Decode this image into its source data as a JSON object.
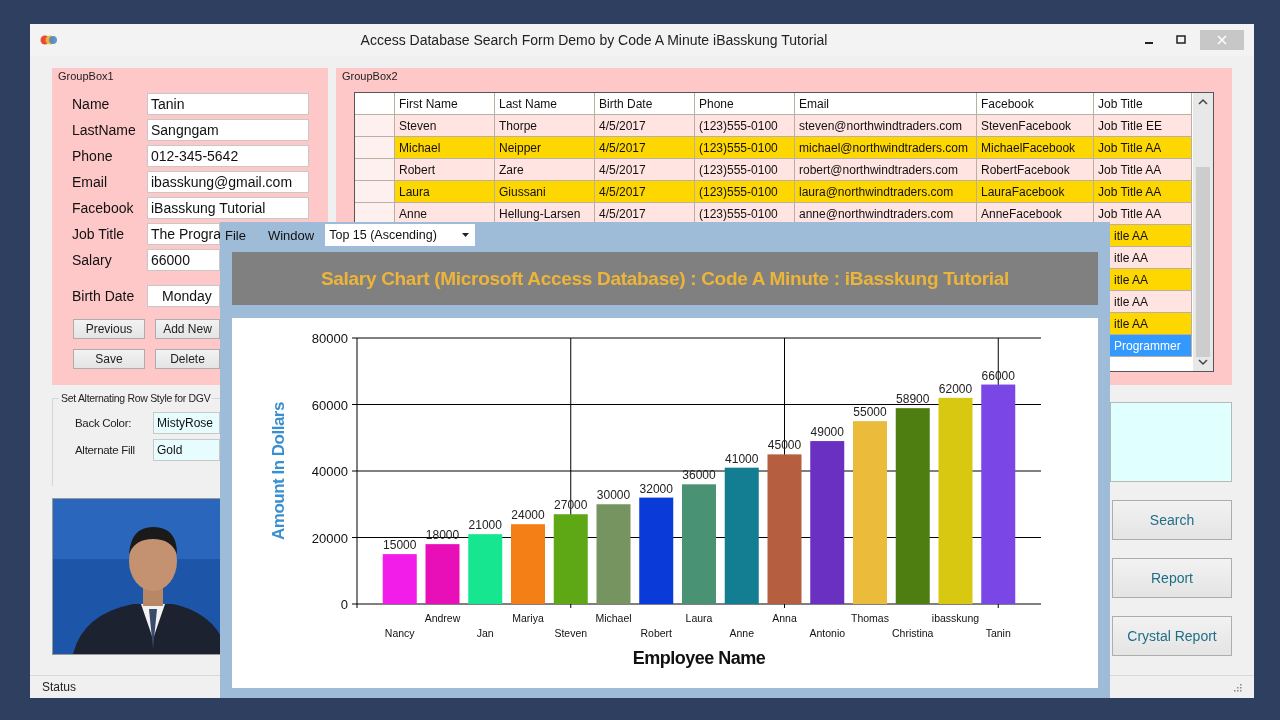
{
  "window": {
    "title": "Access Database Search Form Demo by Code A Minute iBasskung Tutorial"
  },
  "groupbox1": {
    "title": "GroupBox1",
    "fields": [
      {
        "label": "Name",
        "value": "Tanin"
      },
      {
        "label": "LastName",
        "value": "Sangngam"
      },
      {
        "label": "Phone",
        "value": "012-345-5642"
      },
      {
        "label": "Email",
        "value": "ibasskung@gmail.com"
      },
      {
        "label": "Facebook",
        "value": "iBasskung Tutorial"
      },
      {
        "label": "Job Title",
        "value": "The Progra",
        "cut": true
      },
      {
        "label": "Salary",
        "value": "66000",
        "cut": true
      }
    ],
    "birth_date": {
      "label": "Birth Date",
      "value": "Monday"
    },
    "buttons": [
      "Previous",
      "Add New",
      "Save",
      "Delete"
    ]
  },
  "alternating_style": {
    "title": "Set Alternating Row Style for DGV",
    "fields": [
      {
        "label": "Back Color:",
        "value": "MistyRose"
      },
      {
        "label": "Alternate Fill",
        "value": "Gold"
      }
    ]
  },
  "photo": {
    "kind": "picture"
  },
  "groupbox2": {
    "title": "GroupBox2",
    "table": {
      "columns": [
        "First Name",
        "Last Name",
        "Birth Date",
        "Phone",
        "Email",
        "Facebook",
        "Job Title"
      ],
      "rows": [
        {
          "cells": [
            "Steven",
            "Thorpe",
            "4/5/2017",
            "(123)555-0100",
            "steven@northwindtraders.com",
            "StevenFacebook",
            "Job Title EE"
          ],
          "selected": false
        },
        {
          "cells": [
            "Michael",
            "Neipper",
            "4/5/2017",
            "(123)555-0100",
            "michael@northwindtraders.com",
            "MichaelFacebook",
            "Job Title AA"
          ],
          "selected": false
        },
        {
          "cells": [
            "Robert",
            "Zare",
            "4/5/2017",
            "(123)555-0100",
            "robert@northwindtraders.com",
            "RobertFacebook",
            "Job Title AA"
          ],
          "selected": false
        },
        {
          "cells": [
            "Laura",
            "Giussani",
            "4/5/2017",
            "(123)555-0100",
            "laura@northwindtraders.com",
            "LauraFacebook",
            "Job Title AA"
          ],
          "selected": false
        },
        {
          "cells": [
            "Anne",
            "Hellung-Larsen",
            "4/5/2017",
            "(123)555-0100",
            "anne@northwindtraders.com",
            "AnneFacebook",
            "Job Title AA"
          ],
          "selected": false
        },
        {
          "cells": [
            "itle AA"
          ],
          "selected": false
        },
        {
          "cells": [
            "itle AA"
          ],
          "selected": false
        },
        {
          "cells": [
            "itle AA"
          ],
          "selected": false
        },
        {
          "cells": [
            "itle AA"
          ],
          "selected": false
        },
        {
          "cells": [
            "itle AA"
          ],
          "selected": false
        },
        {
          "cells": [
            "Programmer"
          ],
          "selected": true
        }
      ]
    }
  },
  "buttons": [
    "Search",
    "Report",
    "Crystal Report"
  ],
  "status_bar": "Status",
  "chart_window": {
    "menu": [
      "File",
      "Window"
    ],
    "view_select": "Top 15 (Ascending)",
    "header": "Salary Chart (Microsoft Access Database) : Code A Minute : iBasskung Tutorial",
    "chart_data": {
      "type": "bar",
      "xlabel": "Employee Name",
      "ylabel": "Amount In Dollars",
      "categories": [
        "Nancy",
        "Andrew",
        "Jan",
        "Mariya",
        "Steven",
        "Michael",
        "Robert",
        "Laura",
        "Anne",
        "Anna",
        "Antonio",
        "Thomas",
        "Christina",
        "ibasskung",
        "Tanin"
      ],
      "values": [
        15000,
        18000,
        21000,
        24000,
        27000,
        30000,
        32000,
        36000,
        41000,
        45000,
        49000,
        55000,
        58900,
        62000,
        66000
      ],
      "colors": [
        "#f21de8",
        "#e90fb8",
        "#17e690",
        "#f47f17",
        "#5ea816",
        "#76945f",
        "#0a3ad8",
        "#4a9274",
        "#137d91",
        "#b55f40",
        "#6a30c2",
        "#ebbb3b",
        "#4e7d12",
        "#d8c812",
        "#7a47e6"
      ],
      "ylim": [
        0,
        80000
      ],
      "yticks": [
        0,
        20000,
        40000,
        60000,
        80000
      ],
      "grid": true,
      "data_labels": true
    }
  }
}
